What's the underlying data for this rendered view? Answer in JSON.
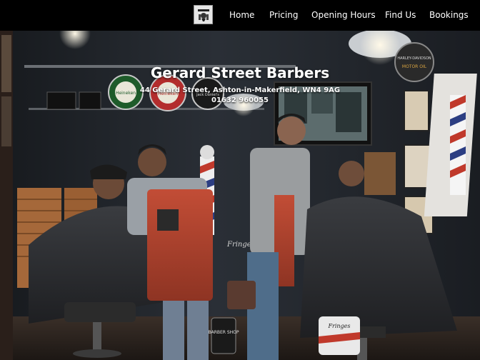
{
  "nav": {
    "logo_alt": "barber logo",
    "links": [
      "Home",
      "Pricing",
      "Opening Hours",
      "Find Us",
      "Bookings"
    ]
  },
  "hero": {
    "title": "Gerard Street Barbers",
    "address": "44 Gerard Street, Ashton-in-Makerfield, WN4 9AG",
    "phone": "01632 960055"
  },
  "scene_signs": {
    "beer_1": "Heineken",
    "beer_2": "Heineken",
    "whisky": "Jack Daniel's",
    "harley": "HARLEY-DAVIDSON",
    "motor_oil": "MOTOR OIL",
    "mural": "Fringes",
    "barber_shop": "BARBER SHOP",
    "drum": "Fringes"
  },
  "colors": {
    "nav_bg": "#000000",
    "nav_text": "#ffffff",
    "apron": "#b5432f"
  }
}
